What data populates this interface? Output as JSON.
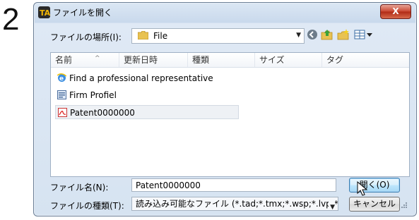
{
  "step_number": "2",
  "dialog": {
    "title": "ファイルを開く",
    "close_label": "X",
    "location_label": "ファイルの場所(I):",
    "location_value": "File",
    "columns": [
      "名前",
      "更新日時",
      "種類",
      "サイズ",
      "タグ"
    ],
    "files": [
      {
        "name": "Find a professional representative",
        "icon": "ie-shortcut-icon"
      },
      {
        "name": "Firm Profiel",
        "icon": "document-icon"
      },
      {
        "name": "Patent0000000",
        "icon": "pdf-icon"
      }
    ],
    "filename_label": "ファイル名(N):",
    "filename_value": "Patent0000000",
    "filetype_label": "ファイルの種類(T):",
    "filetype_value": "読み込み可能なファイル (*.tad;*.tmx;*.wsp;*.lvp;*.h",
    "open_label": "開く(O)",
    "cancel_label": "キャンセル"
  },
  "colors": {
    "accent": "#3c7fb1",
    "close": "#c9452f",
    "frame": "#c9d9ec"
  }
}
